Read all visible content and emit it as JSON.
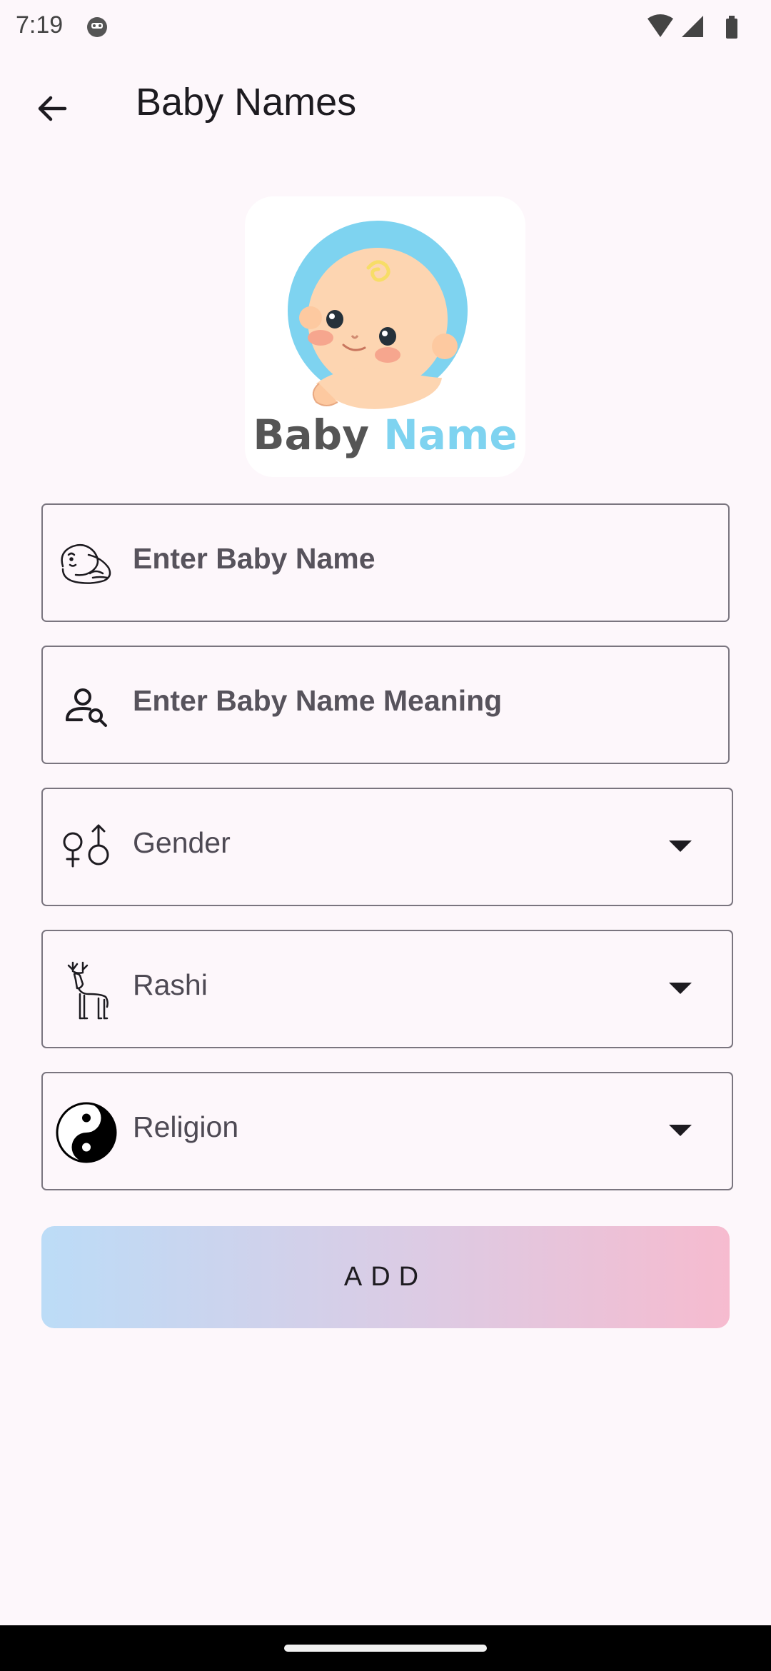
{
  "status_bar": {
    "time": "7:19"
  },
  "app_bar": {
    "title": "Baby Names"
  },
  "logo": {
    "word1": "Baby",
    "word2": "Name",
    "word1_color": "#555555",
    "word2_color": "#7ed3f0"
  },
  "form": {
    "name_field": {
      "placeholder": "Enter Baby Name",
      "icon": "baby-icon"
    },
    "meaning_field": {
      "placeholder": "Enter Baby Name Meaning",
      "icon": "person-search-icon"
    },
    "gender_select": {
      "label": "Gender",
      "icon": "gender-icon"
    },
    "rashi_select": {
      "label": "Rashi",
      "icon": "deer-icon"
    },
    "religion_select": {
      "label": "Religion",
      "icon": "yin-yang-icon"
    },
    "add_button": {
      "label": "ADD"
    }
  },
  "colors": {
    "background": "#fdf7fb",
    "field_border": "#7a757f",
    "button_gradient_start": "#bcdcf7",
    "button_gradient_end": "#f6bbcf"
  }
}
